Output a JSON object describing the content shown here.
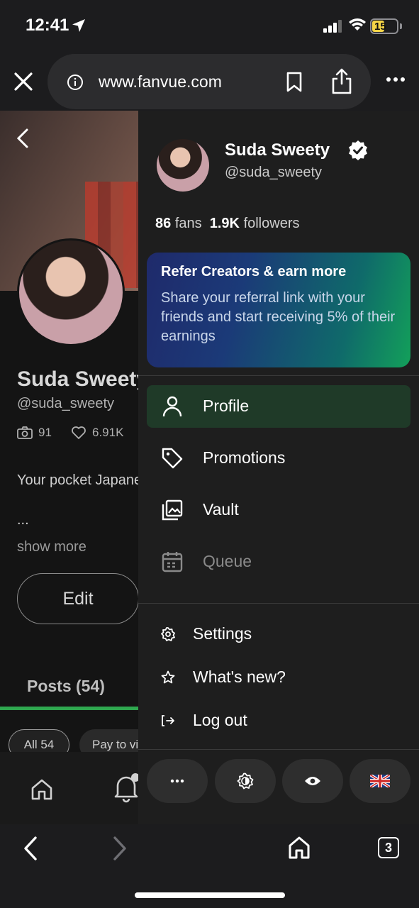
{
  "status": {
    "time": "12:41",
    "battery": "15"
  },
  "browser": {
    "url": "www.fanvue.com",
    "tab_count": "3"
  },
  "profile_page": {
    "name": "Suda Sweety",
    "handle": "@suda_sweety",
    "posts_count_stat": "91",
    "likes_stat": "6.91K",
    "bio": "Your pocket Japanese",
    "ellipsis": "...",
    "show_more": "show more",
    "edit_label": "Edit",
    "posts_tab": "Posts (54)",
    "chip_all": "All 54",
    "chip_pay": "Pay to view"
  },
  "drawer": {
    "name": "Suda Sweety",
    "handle": "@suda_sweety",
    "fans_count": "86",
    "fans_label": "fans",
    "followers_count": "1.9K",
    "followers_label": "followers",
    "refer": {
      "title": "Refer Creators & earn more",
      "body": "Share your referral link with your friends and start receiving 5% of their earnings"
    },
    "menu": [
      {
        "label": "Profile",
        "icon": "person-icon"
      },
      {
        "label": "Promotions",
        "icon": "tag-icon"
      },
      {
        "label": "Vault",
        "icon": "images-icon"
      },
      {
        "label": "Queue",
        "icon": "calendar-icon"
      }
    ],
    "sub_menu": [
      {
        "label": "Settings",
        "icon": "gear-icon"
      },
      {
        "label": "What's new?",
        "icon": "star-icon"
      },
      {
        "label": "Log out",
        "icon": "logout-icon"
      }
    ],
    "bottom_buttons": [
      "more-icon",
      "theme-icon",
      "eye-icon",
      "uk-flag-icon"
    ]
  },
  "colors": {
    "active_bg": "#1f3a28",
    "accent_green": "#2fa84f",
    "battery_yellow": "#f5d547"
  }
}
